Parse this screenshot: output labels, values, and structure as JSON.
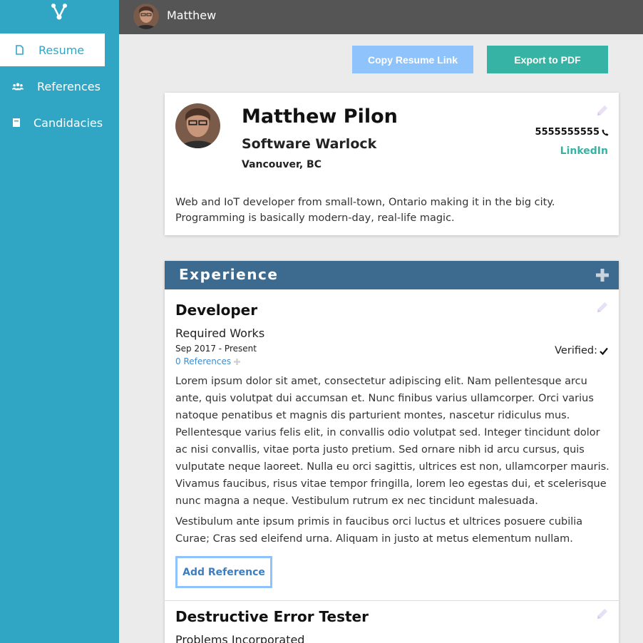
{
  "nav": {
    "items": [
      {
        "label": "Resume",
        "icon": "document-icon",
        "active": true
      },
      {
        "label": "References",
        "icon": "people-icon",
        "active": false
      },
      {
        "label": "Candidacies",
        "icon": "file-icon",
        "active": false
      }
    ]
  },
  "topbar": {
    "user_name": "Matthew"
  },
  "actions": {
    "copy_label": "Copy Resume Link",
    "export_label": "Export to PDF"
  },
  "profile": {
    "name": "Matthew Pilon",
    "title": "Software Warlock",
    "location": "Vancouver, BC",
    "phone": "5555555555",
    "linkedin": "LinkedIn",
    "bio": "Web and IoT developer from small-town, Ontario making it in the big city. Programming is basically modern-day, real-life magic."
  },
  "experience": {
    "heading": "Experience",
    "jobs": [
      {
        "title": "Developer",
        "company": "Required Works",
        "dates": "Sep 2017 - Present",
        "references": "0 References",
        "verified_label": "Verified:",
        "description_1": "Lorem ipsum dolor sit amet, consectetur adipiscing elit. Nam pellentesque arcu ante, quis volutpat dui accumsan et. Nunc finibus varius ullamcorper. Orci varius natoque penatibus et magnis dis parturient montes, nascetur ridiculus mus. Pellentesque varius felis elit, in convallis odio volutpat sed. Integer tincidunt dolor ac nisi convallis, vitae porta justo pretium. Sed ornare nibh id arcu cursus, quis vulputate neque laoreet. Nulla eu orci sagittis, ultrices est non, ullamcorper mauris. Vivamus faucibus, risus vitae tempor fringilla, lorem leo egestas dui, et scelerisque nunc magna a neque. Vestibulum rutrum ex nec tincidunt malesuada.",
        "description_2": "Vestibulum ante ipsum primis in faucibus orci luctus et ultrices posuere cubilia Curae; Cras sed eleifend urna. Aliquam in justo at metus elementum nullam.",
        "add_reference_label": "Add Reference"
      },
      {
        "title": "Destructive Error Tester",
        "company": "Problems Incorporated"
      }
    ]
  },
  "colors": {
    "sidebar": "#31a6c4",
    "topbar": "#555555",
    "copy_button": "#8ec3fb",
    "export_button": "#36b3a4",
    "experience_header": "#3d6a8f",
    "link": "#3d8ed0"
  }
}
